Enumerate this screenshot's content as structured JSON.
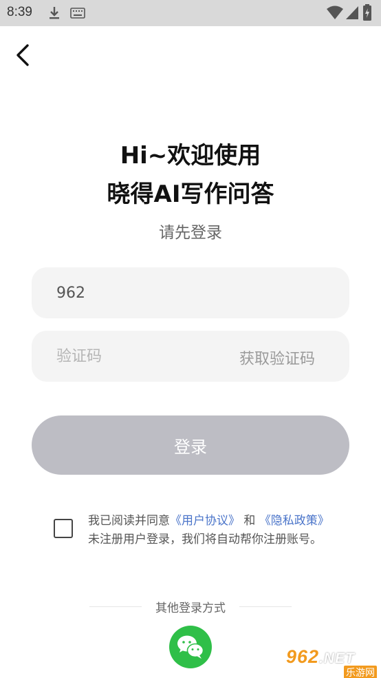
{
  "status_bar": {
    "time": "8:39",
    "icons": [
      "download-icon",
      "keyboard-icon",
      "wifi-icon",
      "signal-icon",
      "battery-icon"
    ]
  },
  "nav": {
    "back_icon": "chevron-left-icon"
  },
  "header": {
    "title_line1": "Hi~欢迎使用",
    "title_line2": "晓得AI写作问答",
    "subtitle": "请先登录"
  },
  "form": {
    "phone_value": "962",
    "code_placeholder": "验证码",
    "get_code_label": "获取验证码",
    "login_label": "登录"
  },
  "agreement": {
    "prefix": "我已阅读并同意",
    "user_agreement": "《用户协议》",
    "and": "和",
    "privacy_policy": "《隐私政策》",
    "line2": "未注册用户登录，我们将自动帮你注册账号。"
  },
  "other_login": {
    "label": "其他登录方式",
    "wechat_icon": "wechat-icon"
  },
  "watermark": {
    "logo": "962",
    "logo_suffix": ".NET",
    "subtitle": "乐游网"
  },
  "colors": {
    "link": "#4a74c9",
    "button_disabled": "#bdbdc4",
    "wechat_green": "#2fbf48",
    "field_bg": "#f4f4f4"
  }
}
